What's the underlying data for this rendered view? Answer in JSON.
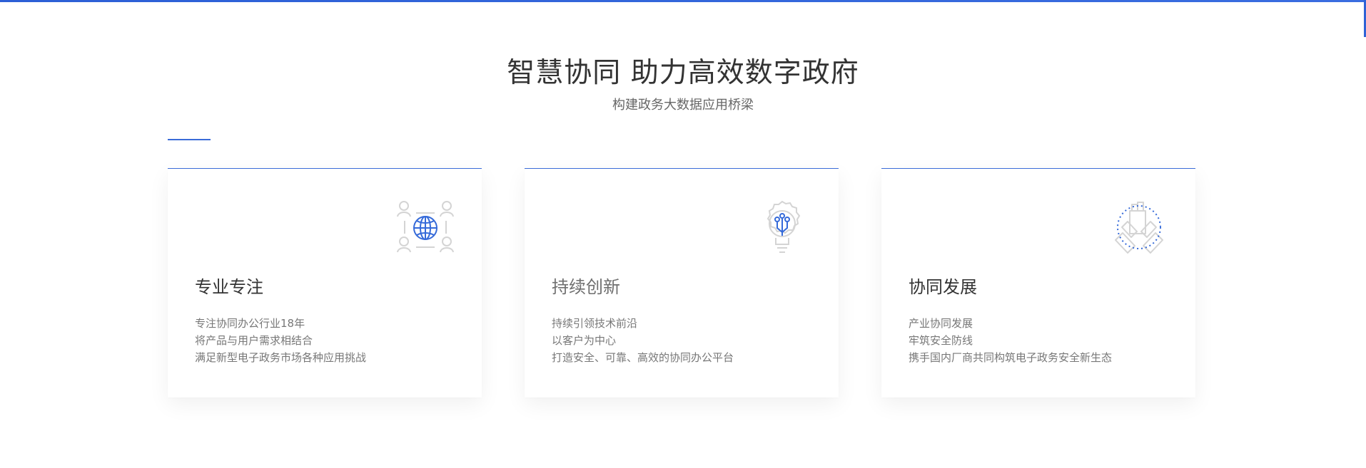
{
  "header": {
    "title": "智慧协同 助力高效数字政府",
    "subtitle": "构建政务大数据应用桥梁"
  },
  "cards": [
    {
      "icon": "globe-network-icon",
      "title": "专业专注",
      "lines": [
        "专注协同办公行业18年",
        "将产品与用户需求相结合",
        "满足新型电子政务市场各种应用挑战"
      ]
    },
    {
      "icon": "innovation-bulb-gear-icon",
      "title": "持续创新",
      "lines": [
        "持续引领技术前沿",
        "以客户为中心",
        "打造安全、可靠、高效的协同办公平台"
      ]
    },
    {
      "icon": "collaboration-hands-icon",
      "title": "协同发展",
      "lines": [
        "产业协同发展",
        "牢筑安全防线",
        "携手国内厂商共同构筑电子政务安全新生态"
      ]
    }
  ],
  "colors": {
    "accent": "#3a6bd8",
    "title": "#333333",
    "body": "#777777"
  }
}
